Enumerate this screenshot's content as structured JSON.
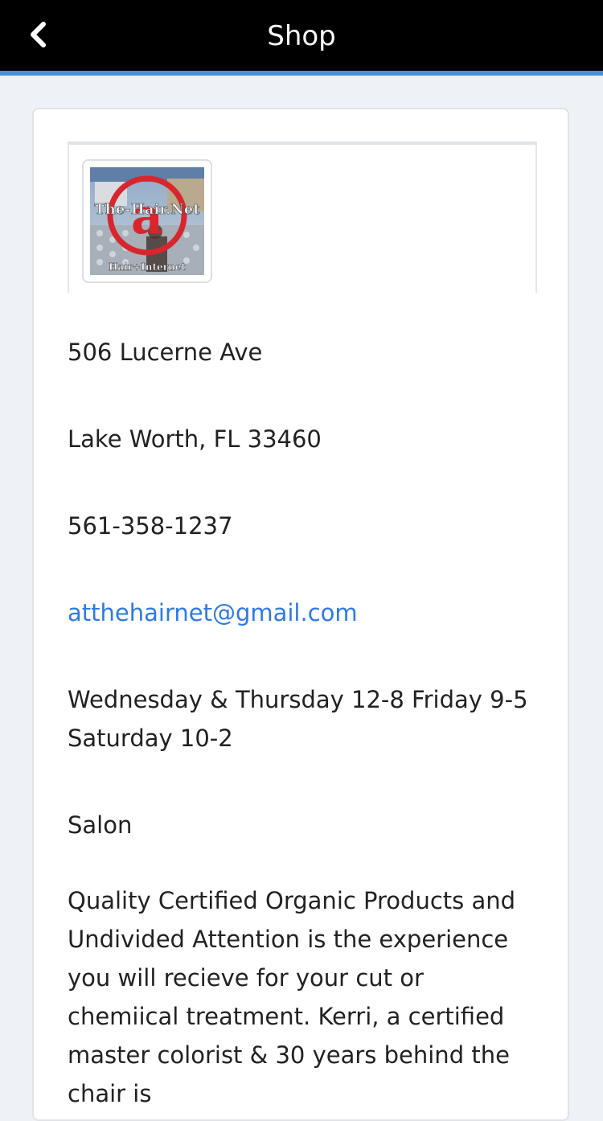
{
  "header": {
    "title": "Shop",
    "back_icon": "chevron-left-icon",
    "background": "#000000",
    "accent": "#4a8fd9"
  },
  "shop": {
    "logo": {
      "brand_text": "The-Hair.Net",
      "tagline_text": "Hair+Internet",
      "symbol": "@"
    },
    "address_line1": "506 Lucerne Ave",
    "address_line2": "Lake Worth, FL 33460",
    "phone": "561-358-1237",
    "email": "atthehairnet@gmail.com",
    "hours": "Wednesday & Thursday 12-8 Friday 9-5 Saturday 10-2",
    "category": "Salon",
    "description": "Quality Certified Organic Products and Undivided Attention is the experience you will recieve for your cut or chemiical treatment. Kerri, a certified master colorist & 30 years behind the chair is"
  },
  "colors": {
    "link": "#2f7ae5",
    "page_bg": "#eef1f5"
  }
}
